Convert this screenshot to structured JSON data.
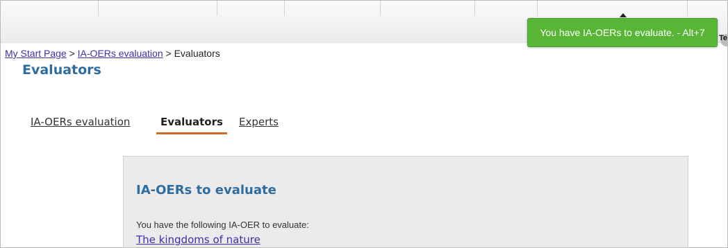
{
  "notification": {
    "message": "You have IA-OERs to evaluate. - Alt+7",
    "color": "#58b536"
  },
  "header": {
    "user_cut_text": "Tes"
  },
  "breadcrumb": {
    "home": "My Start Page",
    "sep1": " > ",
    "section": "IA-OERs evaluation",
    "sep2": " > ",
    "current": "Evaluators"
  },
  "page": {
    "title": "Evaluators"
  },
  "tabs": [
    {
      "label": "IA-OERs evaluation",
      "active": false
    },
    {
      "label": "Evaluators",
      "active": true
    },
    {
      "label": "Experts",
      "active": false
    }
  ],
  "panel": {
    "heading": "IA-OERs to evaluate",
    "description": "You have the following IA-OER to evaluate:",
    "items": [
      {
        "title": "The kingdoms of nature"
      }
    ]
  },
  "colors": {
    "heading": "#2f6ca0",
    "link": "#3d2fa8",
    "active_tab_underline": "#cf6a1e"
  }
}
